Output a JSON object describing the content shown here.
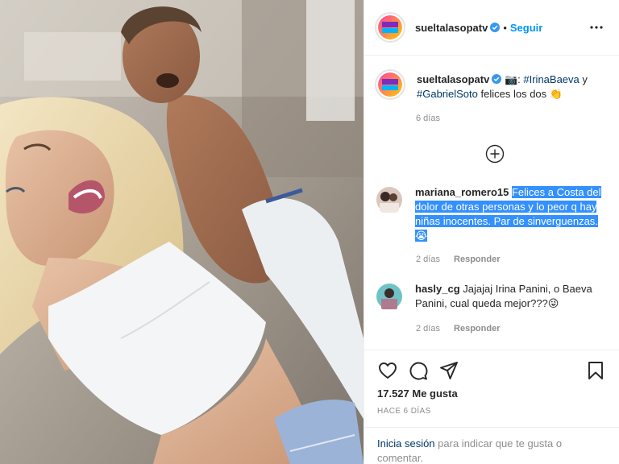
{
  "account": {
    "username": "sueltalasopatv",
    "logo_text_top": "SUELTA",
    "logo_text_bottom": "LA SOPA",
    "follow_label": "Seguir",
    "dot": "•"
  },
  "caption": {
    "username": "sueltalasopatv",
    "camera_emoji": "📷",
    "separator": ":",
    "tag_1": "#IrinaBaeva",
    "and": "y",
    "tag_2": "#GabrielSoto",
    "text": "felices los dos",
    "emoji": "👏",
    "time": "6 días"
  },
  "comments": [
    {
      "username": "mariana_romero15",
      "text": "Felices a Costa del dolor de otras personas y lo peor q hay niñas inocentes. Par de sinverguenzas.",
      "emoji": "😭",
      "time": "2 días",
      "reply_label": "Responder"
    },
    {
      "username": "hasly_cg",
      "text": "Jajajaj Irina Panini, o Baeva Panini, cual queda mejor???",
      "emoji": "😜",
      "time": "2 días",
      "reply_label": "Responder"
    }
  ],
  "likes": "17.527 Me gusta",
  "posted_ago": "HACE 6 DÍAS",
  "login": {
    "link": "Inicia sesión",
    "text": "para indicar que te gusta o comentar."
  },
  "icons": {
    "verified": "verified-badge-icon",
    "more": "more-options-icon",
    "load_more": "load-more-comments-icon",
    "like": "heart-icon",
    "comment": "comment-icon",
    "share": "share-icon",
    "save": "bookmark-icon"
  },
  "colors": {
    "accent_blue": "#0095f6",
    "highlight": "#3390ff",
    "hashtag": "#00376b",
    "muted": "#8e8e8e"
  }
}
